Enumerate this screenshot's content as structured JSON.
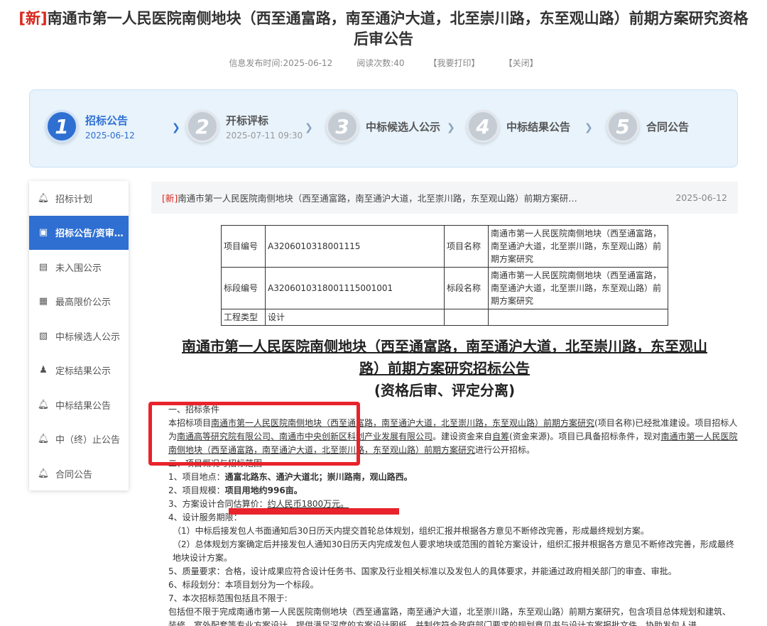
{
  "header": {
    "tag": "[新]",
    "title": "南通市第一人民医院南侧地块（西至通富路，南至通沪大道，北至崇川路，东至观山路）前期方案研究资格后审公告",
    "publish_time": "信息发布时间:2025-06-12",
    "read_count": "阅读次数:40",
    "print_link": "【我要打印】",
    "close_link": "【关闭】"
  },
  "steps": [
    {
      "num": "1",
      "label": "招标公告",
      "date": "2025-06-12"
    },
    {
      "num": "2",
      "label": "开标评标",
      "date": "2025-07-11 09:30"
    },
    {
      "num": "3",
      "label": "中标候选人公示",
      "date": ""
    },
    {
      "num": "4",
      "label": "中标结果公告",
      "date": ""
    },
    {
      "num": "5",
      "label": "合同公告",
      "date": ""
    }
  ],
  "sidebar": {
    "items": [
      {
        "label": "招标计划",
        "icon": "bell-icon"
      },
      {
        "label": "招标公告/资审…",
        "icon": "announcement-icon"
      },
      {
        "label": "未入围公示",
        "icon": "briefcase-icon"
      },
      {
        "label": "最高限价公示",
        "icon": "price-tag-icon"
      },
      {
        "label": "中标候选人公示",
        "icon": "document-edit-icon"
      },
      {
        "label": "定标结果公示",
        "icon": "user-icon"
      },
      {
        "label": "中标结果公告",
        "icon": "bell-icon"
      },
      {
        "label": "中（终）止公告",
        "icon": "bell-icon"
      },
      {
        "label": "合同公告",
        "icon": "bell-icon"
      }
    ]
  },
  "crumb": {
    "tag": "[新]",
    "title": "南通市第一人民医院南侧地块（西至通富路，南至通沪大道，北至崇川路，东至观山路）前期方案研…",
    "date": "2025-06-12"
  },
  "info_table": {
    "project_no_label": "项目编号",
    "project_no": "A3206010318001115",
    "project_name_label": "项目名称",
    "project_name": "南通市第一人民医院南侧地块（西至通富路，南至通沪大道，北至崇川路，东至观山路）前期方案研究",
    "section_no_label": "标段编号",
    "section_no": "A3206010318001115001001",
    "section_name_label": "标段名称",
    "section_name": "南通市第一人民医院南侧地块（西至通富路，南至通沪大道，北至崇川路，东至观山路）前期方案研究",
    "type_label": "工程类型",
    "type": "设计"
  },
  "doc": {
    "title_line1": "南通市第一人民医院南侧地块（西至通富路，南至通沪大道，北至崇川路，东至观山",
    "title_line2": "路）前期方案研究招标公告",
    "subtitle": "(资格后审、评定分离)",
    "sec1": "一、招标条件",
    "p1_a": "本招标项目",
    "p1_name": "南通市第一人民医院南侧地块（西至通富路，南至通沪大道，北至崇川路，东至观山路）前期方案研究",
    "p1_b": "(项目名称)已经批准建设。项目招标人为",
    "p1_owner": "南通高等研究院有限公司、南通市中央创新区科创产业发展有限公司",
    "p1_c": "。建设资金来自",
    "p1_fund": "自筹",
    "p1_d": "(资金来源)。项目已具备招标条件，现对",
    "p1_name2": "南通市第一人民医院南侧地块（西至通富路，南至通沪大道，北至崇川路，东至观山路）前期方案研究",
    "p1_e": "进行公开招标。",
    "sec2": "二、项目概况与招标范围",
    "l1_a": "1、项目地点：",
    "l1_b": "通富北路东、通沪大道北；崇川路南，观山路西。",
    "l2_a": "2、项目规模：",
    "l2_b": "项目用地约996亩。",
    "l3_a": "3、方案设计合同估算价：",
    "l3_b": "约人民币1800万元。",
    "l4": "4、设计服务期限：",
    "l4_1": "（1）中标后接发包人书面通知后30日历天内提交首轮总体规划，组织汇报并根据各方意见不断修改完善，形成最终规划方案。",
    "l4_2": "（2）总体规划方案确定后并接发包人通知30日历天内完成发包人要求地块或范围的首轮方案设计，组织汇报并根据各方意见不断修改完善，形成最终地块设计方案。",
    "l5": "5、质量要求：合格，设计成果应符合设计任务书、国家及行业相关标准以及发包人的具体要求，并能通过政府相关部门的审查、审批。",
    "l6": "6、标段划分：本项目划分为一个标段。",
    "l7": "7、本次招标范围包括且不限于:",
    "l7_body": "包括但不限于完成南通市第一人民医院南侧地块（西至通富路，南至通沪大道，北至崇川路，东至观山路）前期方案研究，包含项目总体规划和建筑、装修、室外配套等专业方案设计，提供满足深度的方案设计图纸，并制作符合政府部门要求的规划意见书与设计方案报批文件，协助发包人进"
  }
}
